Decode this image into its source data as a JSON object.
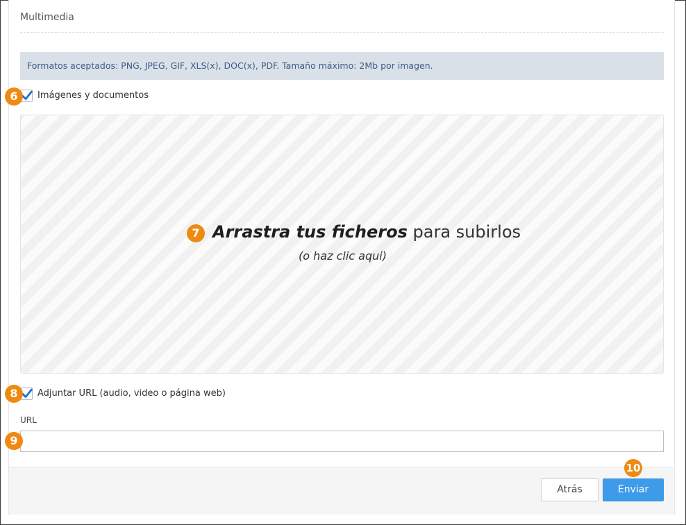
{
  "section": {
    "title": "Multimedia"
  },
  "info": {
    "text": "Formatos aceptados: PNG, JPEG, GIF, XLS(x), DOC(x), PDF. Tamaño máximo: 2Mb por imagen."
  },
  "images_checkbox": {
    "label": "Imágenes y documentos",
    "checked": true
  },
  "dropzone": {
    "main_bold": "Arrastra tus ficheros",
    "main_light": "para subirlos",
    "sub": "(o haz clic aqui)"
  },
  "url_checkbox": {
    "label": "Adjuntar URL (audio, video o página web)",
    "checked": true
  },
  "url_field": {
    "label": "URL",
    "value": ""
  },
  "buttons": {
    "back": "Atrás",
    "send": "Enviar"
  },
  "step_badges": [
    "6",
    "7",
    "8",
    "9",
    "10"
  ],
  "colors": {
    "badge": "#ee8a12",
    "primary_button": "#3d9be9",
    "info_background": "#d9e0e8",
    "info_text": "#3d5c86",
    "check_mark": "#1f6fd1"
  }
}
